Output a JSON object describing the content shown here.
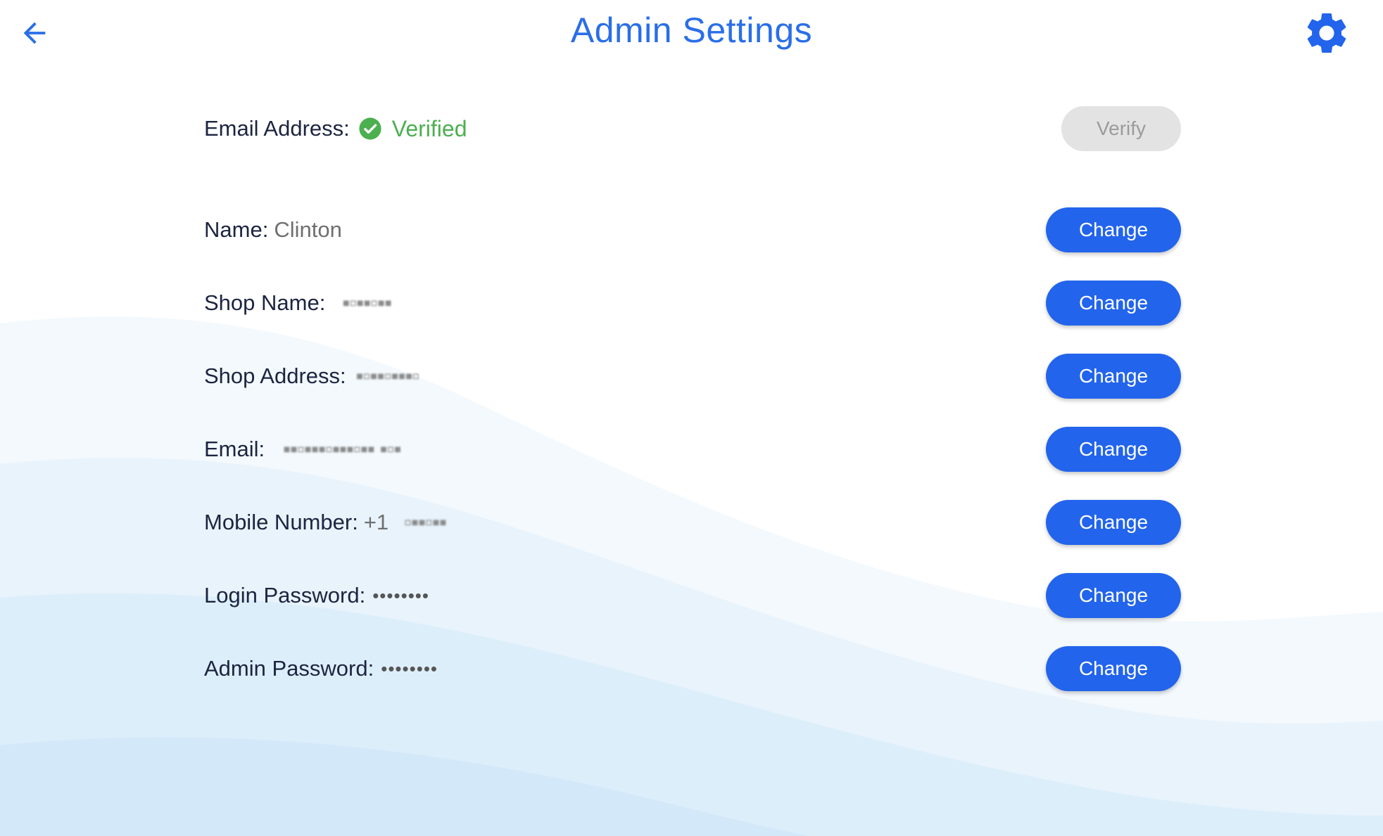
{
  "header": {
    "title": "Admin Settings",
    "back_icon": "arrow-left-icon",
    "settings_icon": "gear-icon"
  },
  "email_status": {
    "label": "Email Address:",
    "status": "Verified",
    "status_icon": "check-circle-icon",
    "verify_label": "Verify"
  },
  "fields": [
    {
      "key": "name",
      "label": "Name:",
      "value": "Clinton",
      "button": "Change"
    },
    {
      "key": "shop_name",
      "label": "Shop Name:",
      "value": "",
      "button": "Change"
    },
    {
      "key": "shop_address",
      "label": "Shop Address:",
      "value": "",
      "button": "Change"
    },
    {
      "key": "email",
      "label": "Email:",
      "value": "",
      "button": "Change"
    },
    {
      "key": "mobile",
      "label": "Mobile Number:",
      "value": "+1",
      "button": "Change"
    },
    {
      "key": "login_password",
      "label": "Login Password:",
      "value": "••••••••",
      "button": "Change"
    },
    {
      "key": "admin_password",
      "label": "Admin Password:",
      "value": "••••••••",
      "button": "Change"
    }
  ],
  "colors": {
    "accent": "#2a6ee8",
    "button": "#2264ec",
    "verified": "#4caf50",
    "disabled_button": "#e3e3e3"
  }
}
